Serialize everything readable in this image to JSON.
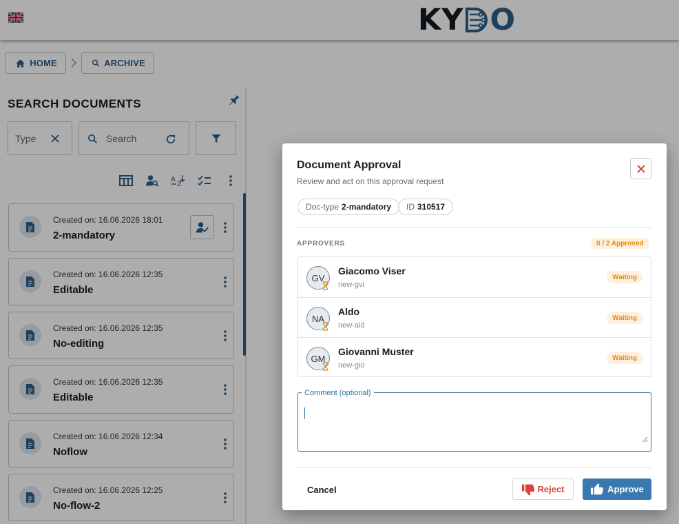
{
  "header": {
    "logo_prefix": "KY",
    "logo_suffix": "O",
    "language": "English (UK flag)",
    "colors": {
      "logo_dark": "#141b22",
      "brand_blue": "#2f5f86"
    }
  },
  "breadcrumb": {
    "home_label": "HOME",
    "archive_label": "ARCHIVE"
  },
  "search_panel": {
    "title": "SEARCH DOCUMENTS",
    "type_placeholder": "Type",
    "search_placeholder": "Search",
    "documents": [
      {
        "created": "Created on: 16.06.2026 18:01",
        "title": "2-mandatory",
        "has_approval": true
      },
      {
        "created": "Created on: 16.06.2026 12:35",
        "title": "Editable"
      },
      {
        "created": "Created on: 16.06.2026 12:35",
        "title": "No-editing"
      },
      {
        "created": "Created on: 16.06.2026 12:35",
        "title": "Editable"
      },
      {
        "created": "Created on: 16.06.2026 12:34",
        "title": "Noflow"
      },
      {
        "created": "Created on: 16.06.2026 12:25",
        "title": "No-flow-2"
      }
    ]
  },
  "dialog": {
    "title": "Document Approval",
    "subtitle": "Review and act on this approval request",
    "doctype_label": "Doc-type",
    "doctype_value": "2-mandatory",
    "id_label": "ID",
    "id_value": "310517",
    "approvers_label": "APPROVERS",
    "approved_count": "0 / 2 Approved",
    "approvers": [
      {
        "initials": "GV",
        "name": "Giacomo Viser",
        "username": "new-gvi",
        "status": "Waiting"
      },
      {
        "initials": "NA",
        "name": "Aldo",
        "username": "new-ald",
        "status": "Waiting"
      },
      {
        "initials": "GM",
        "name": "Giovanni Muster",
        "username": "new-gio",
        "status": "Waiting"
      }
    ],
    "comment_label": "Comment (optional)",
    "comment_value": "",
    "cancel_label": "Cancel",
    "reject_label": "Reject",
    "approve_label": "Approve",
    "colors": {
      "approve": "#3a78b0",
      "reject": "#d9433b",
      "waiting": "#e08a17"
    }
  }
}
